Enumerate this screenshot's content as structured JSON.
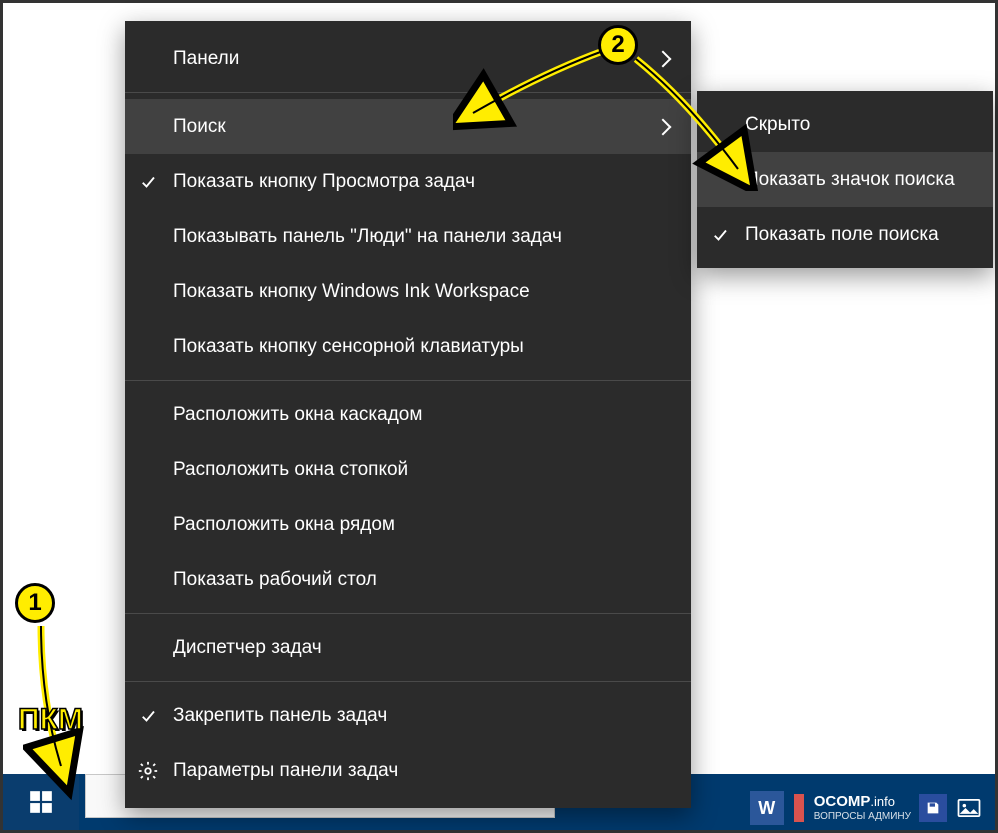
{
  "annotations": {
    "callout1": "1",
    "callout2": "2",
    "pkm": "ПКМ"
  },
  "context_menu": {
    "panels": "Панели",
    "search": "Поиск",
    "task_view": "Показать кнопку Просмотра задач",
    "people": "Показывать панель \"Люди\" на панели задач",
    "ink": "Показать кнопку Windows Ink Workspace",
    "touch_kb": "Показать кнопку сенсорной клавиатуры",
    "cascade": "Расположить окна каскадом",
    "stacked": "Расположить окна стопкой",
    "side_by_side": "Расположить окна рядом",
    "desktop": "Показать рабочий стол",
    "task_manager": "Диспетчер задач",
    "lock": "Закрепить панель задач",
    "settings": "Параметры панели задач"
  },
  "submenu": {
    "hidden": "Скрыто",
    "show_icon": "Показать значок поиска",
    "show_field": "Показать поле поиска"
  },
  "watermark": {
    "brand": "OCOMP",
    "tld": ".info",
    "sub": "ВОПРОСЫ АДМИНУ"
  }
}
